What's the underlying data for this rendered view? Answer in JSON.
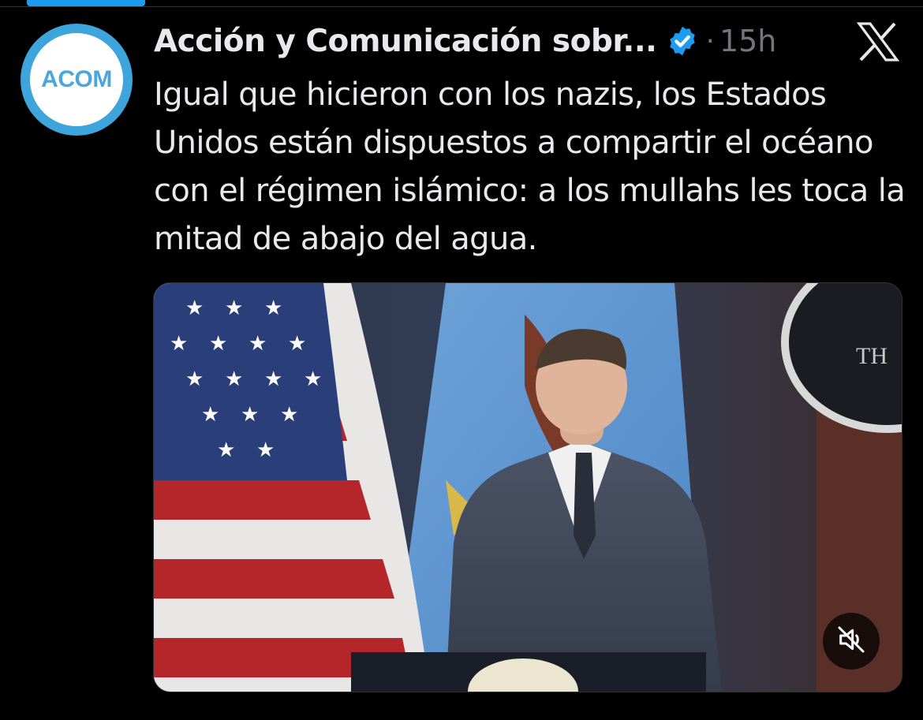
{
  "tweet": {
    "author_name": "Acción y Comunicación sobr...",
    "avatar_text": "ACOM",
    "timestamp": "15h",
    "separator": "·",
    "text": "Igual que hicieron con los nazis, los Estados Unidos están dispuestos a compartir el océano con el régimen islámico: a los mullahs les toca la mitad de abajo del agua.",
    "verified": true
  },
  "media": {
    "type": "video",
    "seal_text": "TH",
    "mute_icon": "speaker-muted-icon"
  },
  "icons": {
    "platform_logo": "x-logo-icon",
    "verified": "verified-badge-icon"
  },
  "colors": {
    "background": "#000000",
    "text": "#e7e9ea",
    "secondary_text": "#71767b",
    "accent": "#1d9bf0",
    "avatar_ring": "#3da5dc"
  }
}
